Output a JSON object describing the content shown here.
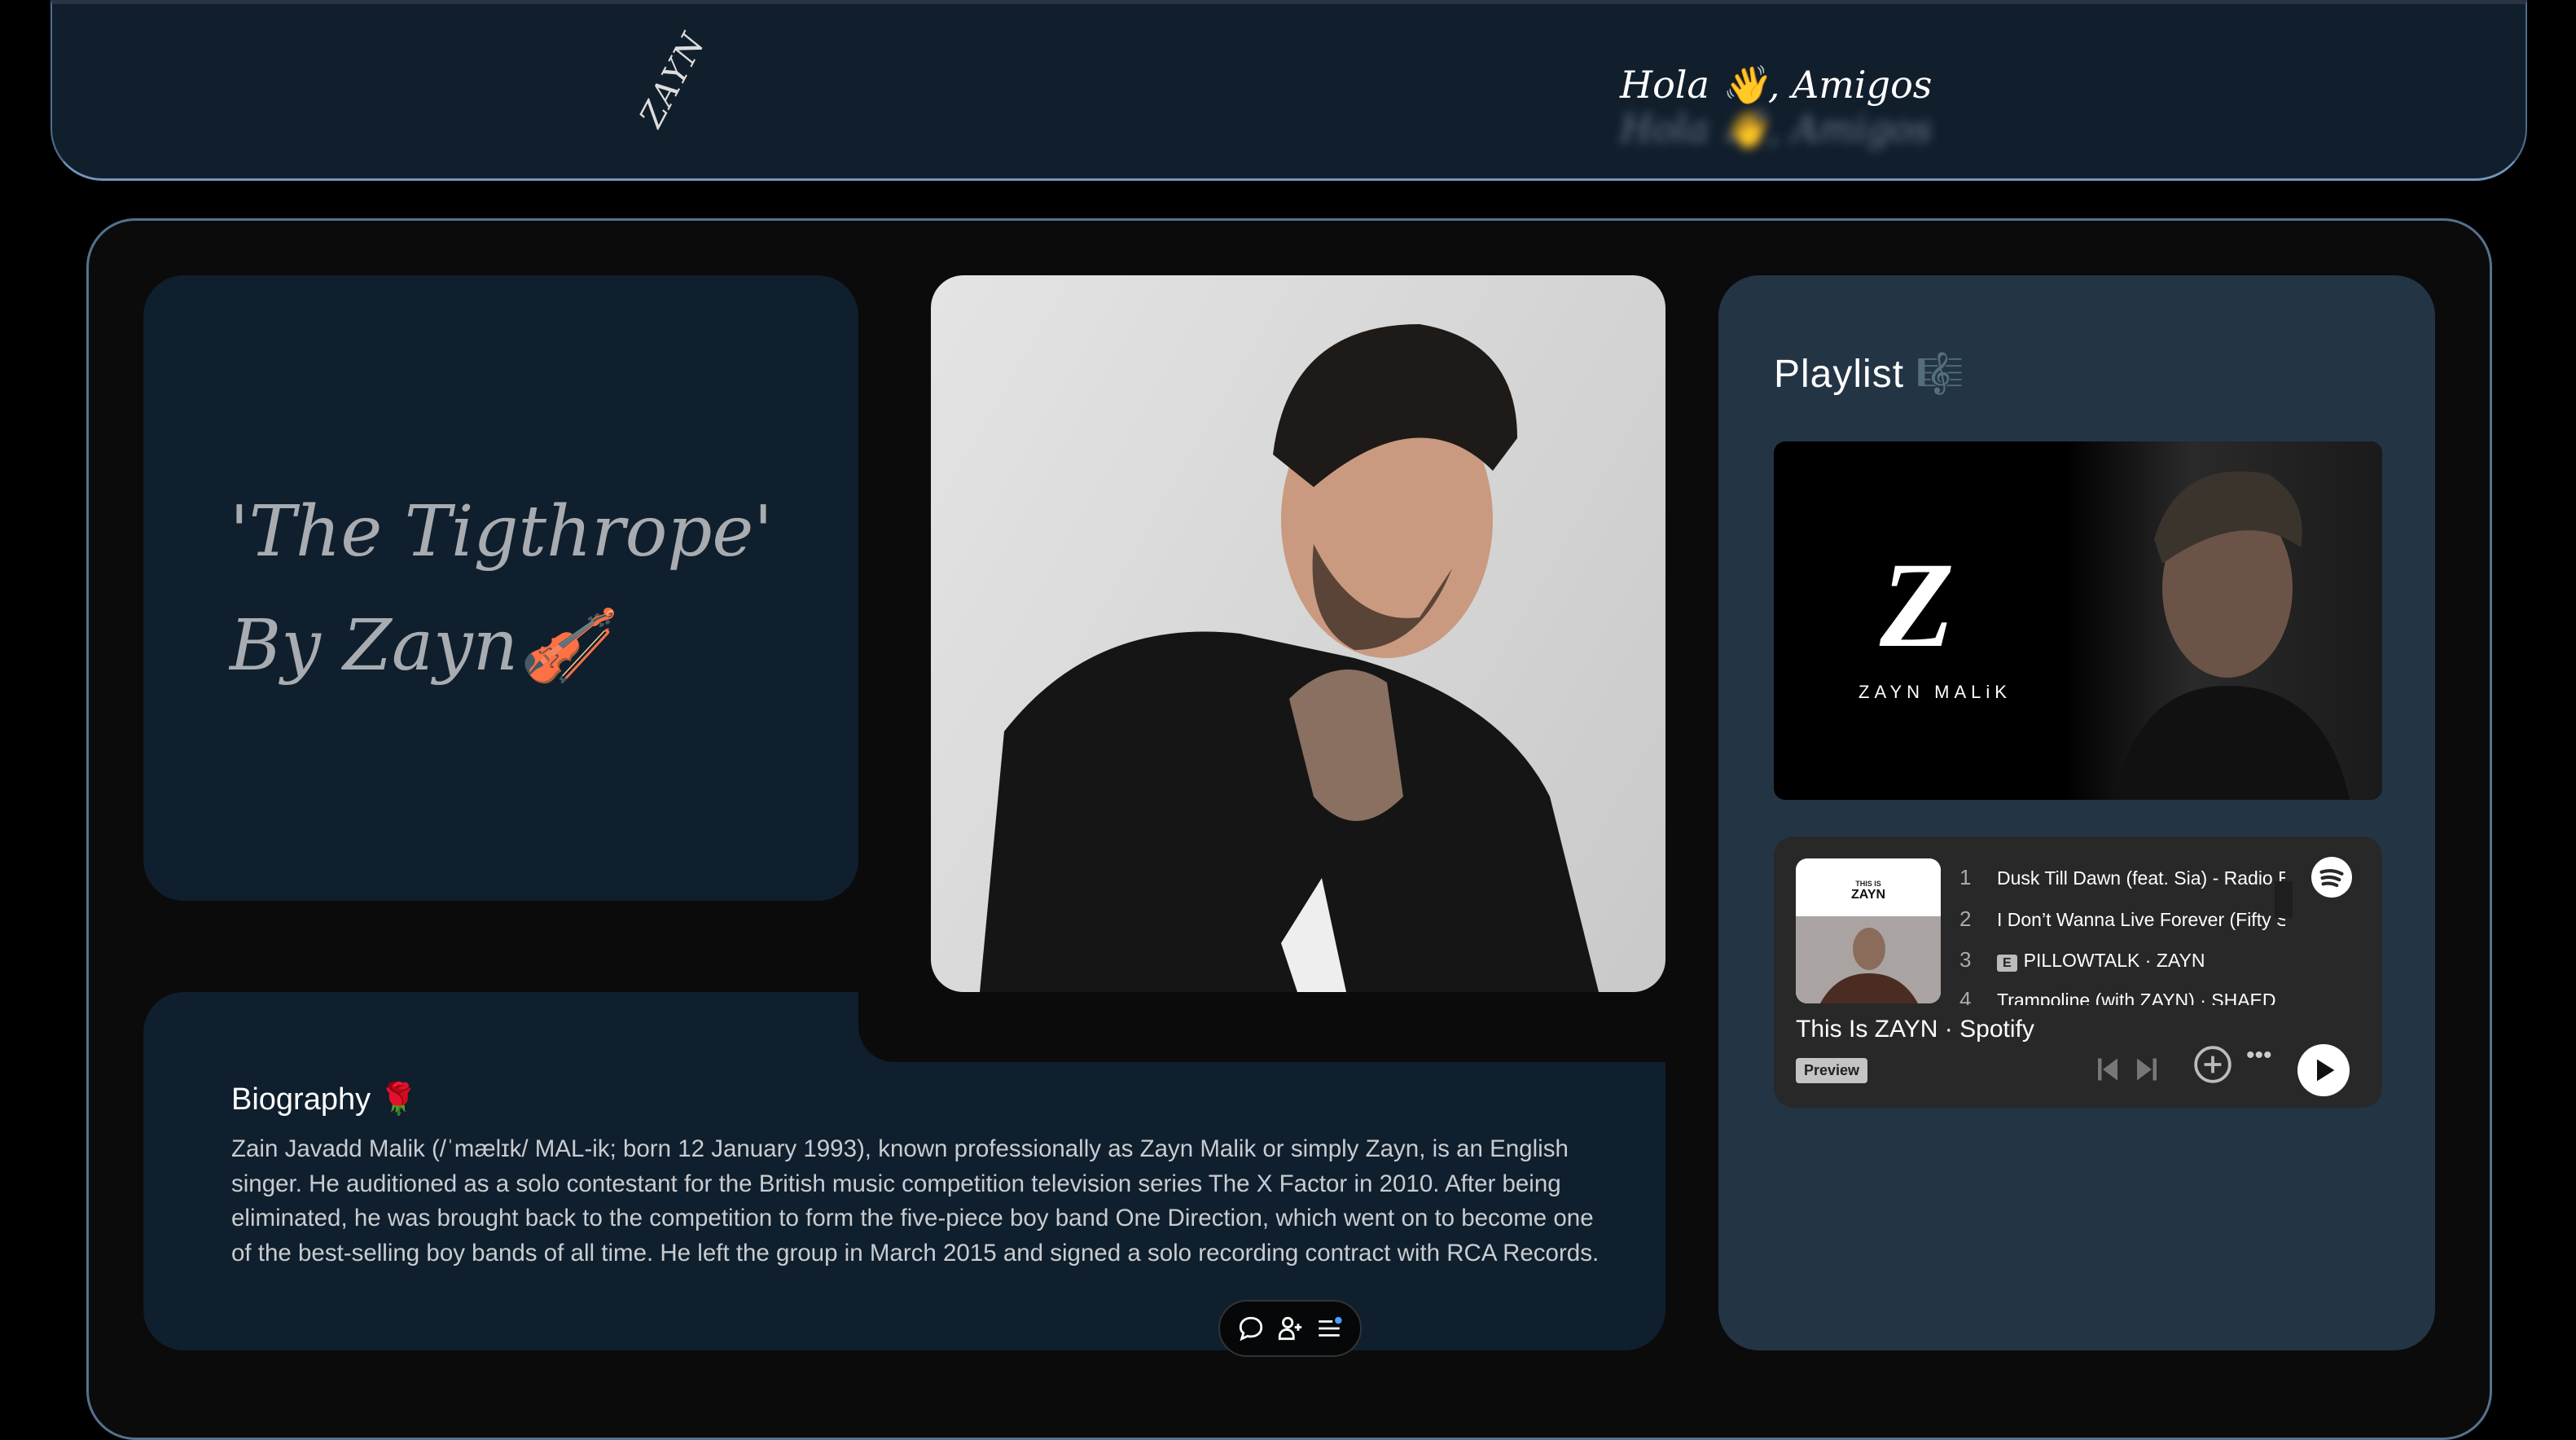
{
  "header": {
    "logo": "ZAYN",
    "greeting": "Hola 👋, Amigos"
  },
  "title_card": {
    "title": "'The Tigthrope'\nBy Zayn🎻"
  },
  "biography": {
    "heading": "Biography 🌹",
    "text": "Zain Javadd Malik (/ˈmælɪk/ MAL-ik; born 12 January 1993), known professionally as Zayn Malik or simply Zayn, is an English singer. He auditioned as a solo contestant for the British music competition television series The X Factor in 2010. After being eliminated, he was brought back to the competition to form the five-piece boy band One Direction, which went on to become one of the best-selling boy bands of all time. He left the group in March 2015 and signed a solo recording contract with RCA Records."
  },
  "playlist": {
    "heading": "Playlist 🎼",
    "banner_text": "ZAYN MALiK",
    "embed": {
      "cover_small": "THIS IS",
      "cover_big": "ZAYN",
      "title": "This Is ZAYN · Spotify",
      "badge": "Preview",
      "tracks": [
        {
          "n": "1",
          "title": "Dusk Till Dawn (feat. Sia) - Radio Edit"
        },
        {
          "n": "2",
          "title": "I Don’t Wanna Live Forever (Fifty Shades Darker)"
        },
        {
          "n": "3",
          "explicit": "E",
          "title": "PILLOWTALK · ZAYN"
        },
        {
          "n": "4",
          "title": "Trampoline (with ZAYN) · SHAED"
        }
      ]
    }
  },
  "toolbar": {
    "icons": [
      "chat-icon",
      "add-user-icon",
      "menu-icon"
    ],
    "dot_color": "#4a9eff"
  },
  "colors": {
    "accent": "#7297bb",
    "card": "#0f1f2d",
    "panel": "#233445"
  }
}
